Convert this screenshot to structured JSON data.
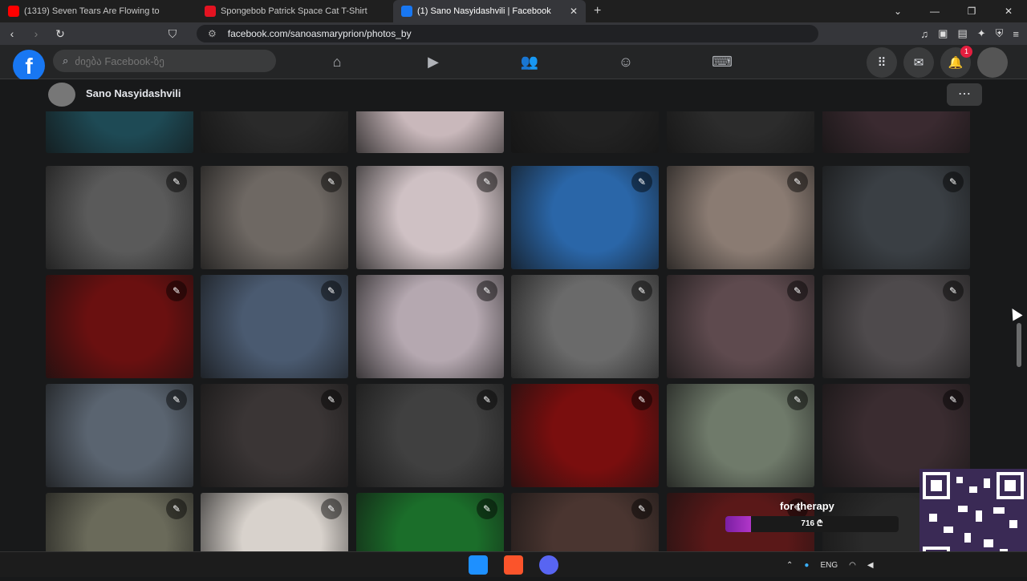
{
  "browser": {
    "tabs": [
      {
        "title": "(1319) Seven Tears Are Flowing to",
        "icon": "youtube-icon",
        "color": "#ff0000"
      },
      {
        "title": "Spongebob Patrick Space Cat T-Shirt",
        "icon": "redbubble-icon",
        "color": "#e41321"
      },
      {
        "title": "(1) Sano Nasyidashvili | Facebook",
        "icon": "facebook-icon",
        "color": "#1877f2",
        "active": true
      }
    ],
    "new_tab_label": "+",
    "url": "facebook.com/sanoasmaryprion/photos_by"
  },
  "facebook": {
    "logo": "f",
    "search_placeholder": "ძიება Facebook-ზე",
    "nav_icons": [
      "home-icon",
      "video-icon",
      "friends-icon",
      "groups-icon",
      "gaming-icon"
    ],
    "notifications_count": "1",
    "accent": "#1877f2"
  },
  "profile": {
    "name": "Sano Nasyidashvili",
    "more_label": "⋯"
  },
  "photos": {
    "edit_icon": "pencil-icon",
    "rows": [
      [
        "#1e4a55",
        "#2a2a2a",
        "#c9b8bb",
        "#222222",
        "#2c2c2c",
        "#3a2a30"
      ],
      [
        "#5a5a5a",
        "#6e6863",
        "#cfc1c4",
        "#2a66a8",
        "#8a7b72",
        "#3a3f44"
      ],
      [
        "#6a1010",
        "#4a5a70",
        "#b5a8b0",
        "#6a6a6a",
        "#5e4a4e",
        "#4e4a4c"
      ],
      [
        "#5a6470",
        "#3a3535",
        "#404040",
        "#7a0e0e",
        "#6f7a6a",
        "#3a2c30"
      ],
      [
        "#6a6a5a",
        "#d8d2cc",
        "#1b6e2a",
        "#4a3530",
        "#5a1818",
        "#2a2a2a"
      ]
    ]
  },
  "overlay": {
    "label": "for therapy",
    "amount": "716 ₾",
    "progress_fraction": 0.15
  },
  "taskbar": {
    "language": "ENG"
  }
}
